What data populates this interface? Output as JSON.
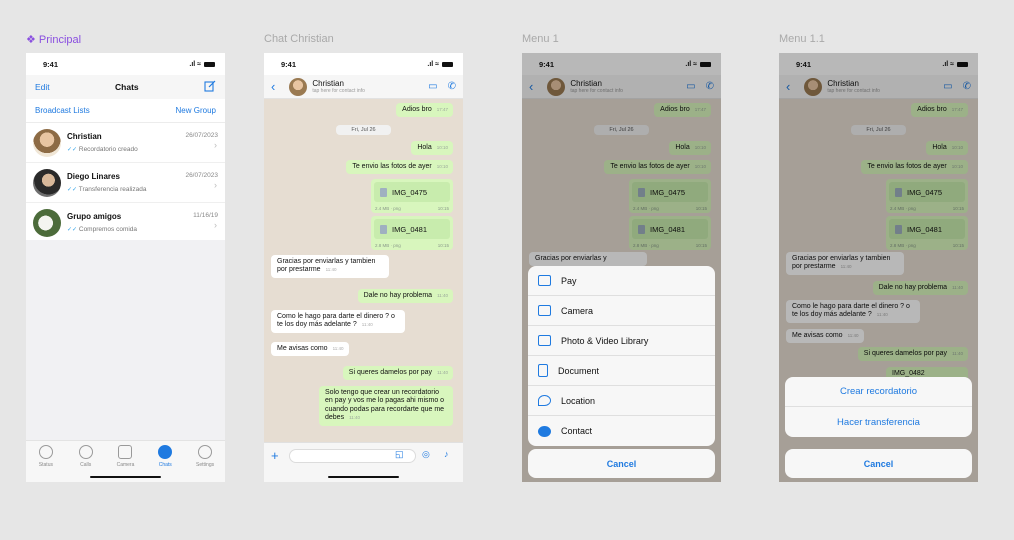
{
  "frames": {
    "principal": "❖ Principal",
    "chat": "Chat Christian",
    "menu1": "Menu 1",
    "menu11": "Menu 1.1"
  },
  "status": {
    "time": "9:41",
    "signal": ".ıl ≈"
  },
  "chats_screen": {
    "edit": "Edit",
    "title": "Chats",
    "broadcast": "Broadcast Lists",
    "new_group": "New Group",
    "rows": [
      {
        "name": "Christian",
        "date": "26/07/2023",
        "preview": "Recordatorio creado"
      },
      {
        "name": "Diego Linares",
        "date": "26/07/2023",
        "preview": "Transferencia realizada"
      },
      {
        "name": "Grupo amigos",
        "date": "11/16/19",
        "preview": "Compremos comida"
      }
    ],
    "tabs": [
      "Status",
      "Calls",
      "Camera",
      "Chats",
      "Settings"
    ]
  },
  "chat": {
    "name": "Christian",
    "subtitle": "tap here for contact info",
    "date_pill": "Fri, Jul 26",
    "msgs": {
      "m1": "Adios bro",
      "m1_t": "17:47",
      "m2": "Hola",
      "m2_t": "10:10",
      "m3": "Te envio las fotos de ayer",
      "m3_t": "10:10",
      "f1": "IMG_0475",
      "f1_meta": "2.4 MB · png",
      "f1_t": "10:15",
      "f2": "IMG_0481",
      "f2_meta": "2.8 MB · png",
      "f2_t": "10:15",
      "m4": "Gracias por enviarlas y tambien por prestarme",
      "m4_t": "11:40",
      "m5": "Dale no hay problema",
      "m5_t": "11:40",
      "m6": "Como le hago para darte el dinero ? o te los doy más adelante ?",
      "m6_t": "11:40",
      "m7": "Me avisas como",
      "m7_t": "11:40",
      "m8": "Si queres damelos por pay",
      "m8_t": "11:40",
      "m9": "Solo tengo que crear un recordatorio en pay y vos me lo pagas ahi mismo o cuando podas para recordarte que me debes",
      "m9_t": "11:40",
      "m4_short": "Gracias por enviarlas y",
      "f3_partial": "IMG_0482"
    }
  },
  "menu1": {
    "items": [
      "Pay",
      "Camera",
      "Photo & Video Library",
      "Document",
      "Location",
      "Contact"
    ],
    "cancel": "Cancel"
  },
  "menu11": {
    "options": [
      "Crear recordatorio",
      "Hacer transferencia"
    ],
    "cancel": "Cancel"
  },
  "colors": {
    "accent": "#1f7ae0",
    "outgoing": "#d8f6bd",
    "chat_bg": "#e6ddd2",
    "brand_label": "#8a4fe0"
  },
  "icons": [
    "compose-icon",
    "back-icon",
    "video-call-icon",
    "phone-icon",
    "plus-icon",
    "sticker-icon",
    "camera-icon",
    "mic-icon"
  ]
}
